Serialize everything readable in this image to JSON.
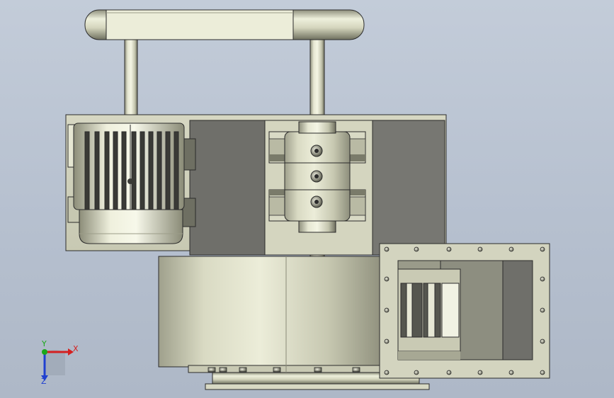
{
  "viewport": {
    "background": "#b9c3d1",
    "part_color": "#cfd0b8",
    "part_shadow": "#7d7e6c",
    "edge_color": "#2b2b2b",
    "dark_panel": "#777772"
  },
  "triad": {
    "x_label": "X",
    "y_label": "Y",
    "z_label": "Z",
    "x_color": "#d42020",
    "y_color": "#1aa81a",
    "z_color": "#2040d0"
  }
}
